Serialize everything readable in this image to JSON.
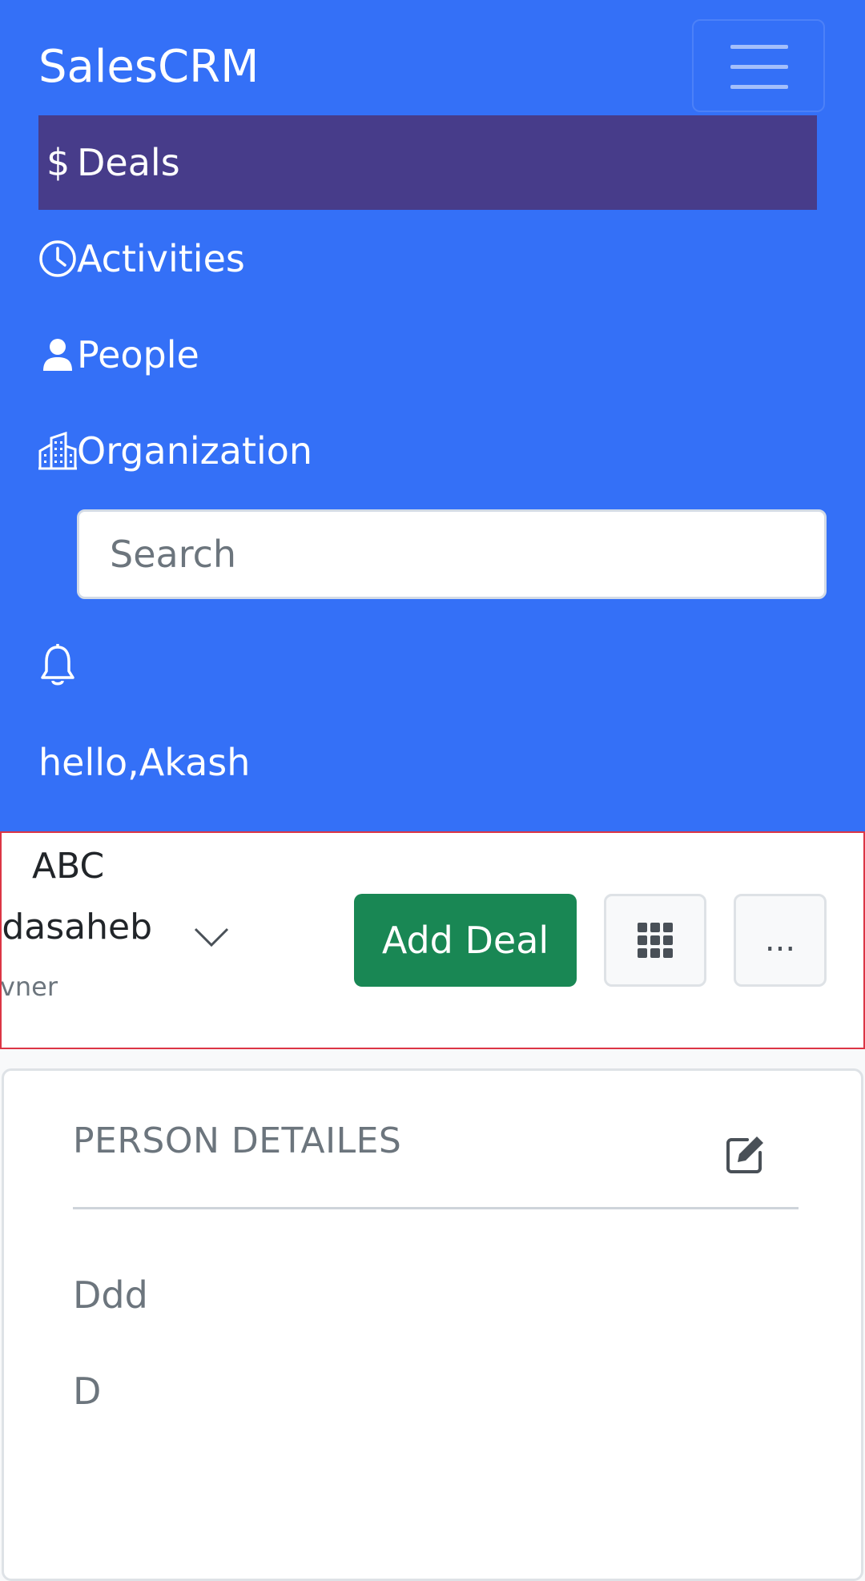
{
  "app": {
    "brand": "SalesCRM"
  },
  "nav": {
    "items": [
      {
        "label": "Deals",
        "icon": "dollar-icon",
        "active": true
      },
      {
        "label": "Activities",
        "icon": "clock-icon",
        "active": false
      },
      {
        "label": "People",
        "icon": "person-icon",
        "active": false
      },
      {
        "label": "Organization",
        "icon": "building-icon",
        "active": false
      }
    ],
    "search_placeholder": "Search",
    "greeting": "hello,Akash"
  },
  "toolbar": {
    "owner": {
      "line1": "ABC",
      "line2": "dasaheb",
      "line3": "vner"
    },
    "add_deal_label": "Add Deal",
    "more_label": "..."
  },
  "person_card": {
    "title": "PERSON DETAILES",
    "fields": [
      "Ddd",
      "D"
    ]
  },
  "colors": {
    "navbar": "#3470f7",
    "active_nav": "#473c8a",
    "primary_button": "#198754",
    "toolbar_border": "#dc3545"
  }
}
